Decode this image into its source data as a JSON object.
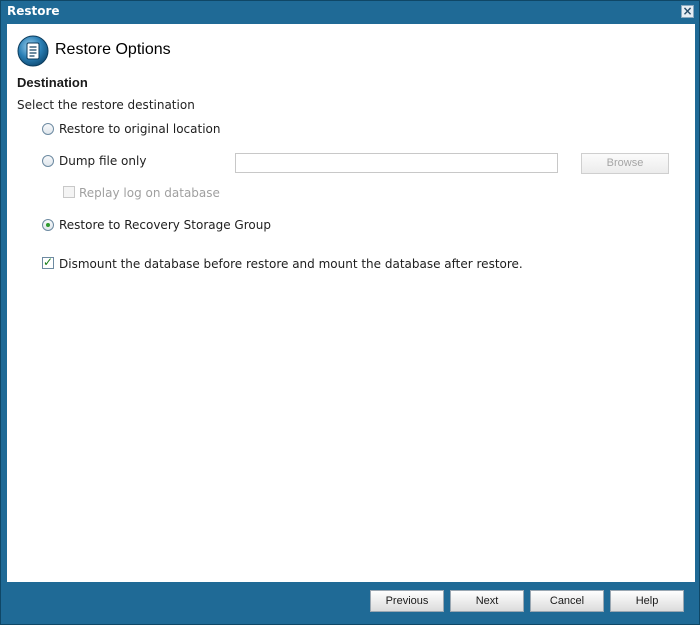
{
  "window": {
    "title": "Restore"
  },
  "header": {
    "title": "Restore Options"
  },
  "section": {
    "title": "Destination",
    "instruction": "Select the restore destination"
  },
  "options": {
    "original": {
      "label": "Restore to original location",
      "checked": false
    },
    "dump": {
      "label": "Dump file only",
      "checked": false
    },
    "replay": {
      "label": "Replay log on database",
      "checked": false,
      "disabled": true
    },
    "recovery": {
      "label": "Restore to Recovery Storage Group",
      "checked": true
    },
    "dismount": {
      "label": "Dismount the database before restore and mount the database after restore.",
      "checked": true
    }
  },
  "dump_path": {
    "value": "",
    "browse_label": "Browse"
  },
  "footer": {
    "previous": "Previous",
    "next": "Next",
    "cancel": "Cancel",
    "help": "Help"
  },
  "colors": {
    "frame": "#1f6a96",
    "accent_check": "#2f9a2f"
  },
  "icons": {
    "header": "restore-options-icon",
    "close": "close-icon"
  }
}
